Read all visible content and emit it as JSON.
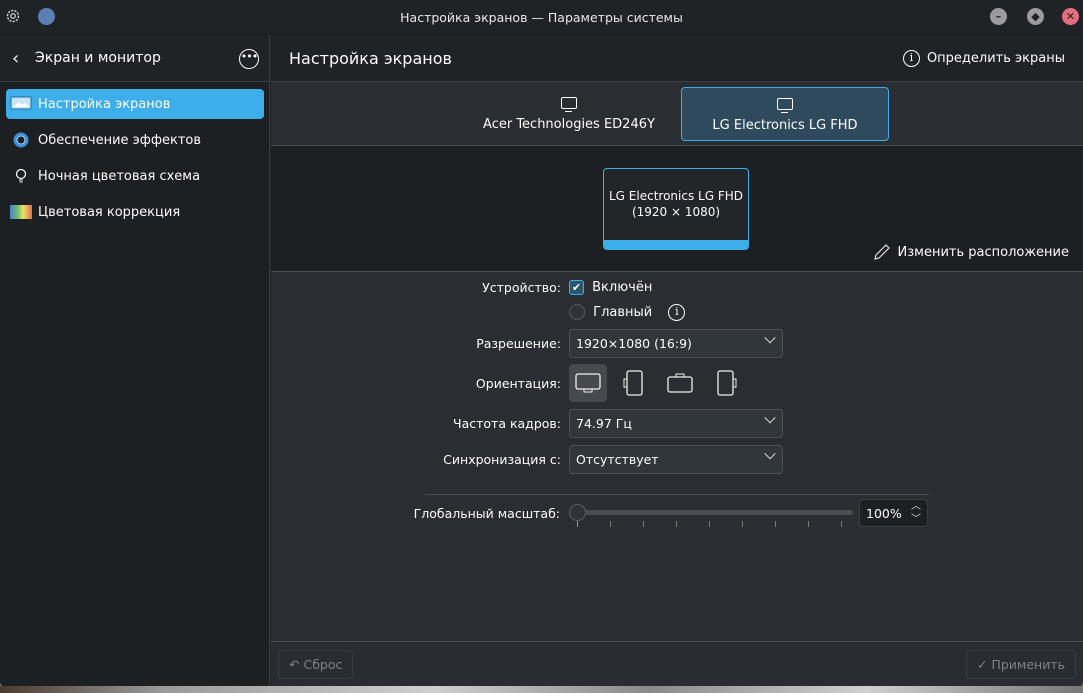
{
  "window": {
    "title": "Настройка экранов — Параметры системы"
  },
  "sidebar": {
    "header": "Экран и монитор",
    "items": [
      {
        "label": "Настройка экранов",
        "active": true
      },
      {
        "label": "Обеспечение эффектов"
      },
      {
        "label": "Ночная цветовая схема"
      },
      {
        "label": "Цветовая коррекция"
      }
    ]
  },
  "main": {
    "title": "Настройка экранов",
    "identify": "Определить экраны",
    "tabs": [
      {
        "label": "Acer Technologies ED246Y"
      },
      {
        "label": "LG Electronics LG FHD",
        "active": true
      }
    ],
    "preview": {
      "name": "LG Electronics LG FHD",
      "resolution": "(1920 × 1080)"
    },
    "edit_layout": "Изменить расположение",
    "form": {
      "device_label": "Устройство:",
      "enabled_label": "Включён",
      "enabled": true,
      "primary_label": "Главный",
      "primary": false,
      "resolution_label": "Разрешение:",
      "resolution": "1920×1080 (16:9)",
      "orientation_label": "Ориентация:",
      "refresh_label": "Частота кадров:",
      "refresh": "74.97 Гц",
      "sync_label": "Синхронизация с:",
      "sync": "Отсутствует",
      "scale_label": "Глобальный масштаб:",
      "scale": "100%",
      "scale_slider_fraction": 0
    },
    "footer": {
      "reset": "Сброс",
      "apply": "Применить"
    }
  },
  "colors": {
    "accent": "#3daee9",
    "background": "#2a2e32"
  }
}
